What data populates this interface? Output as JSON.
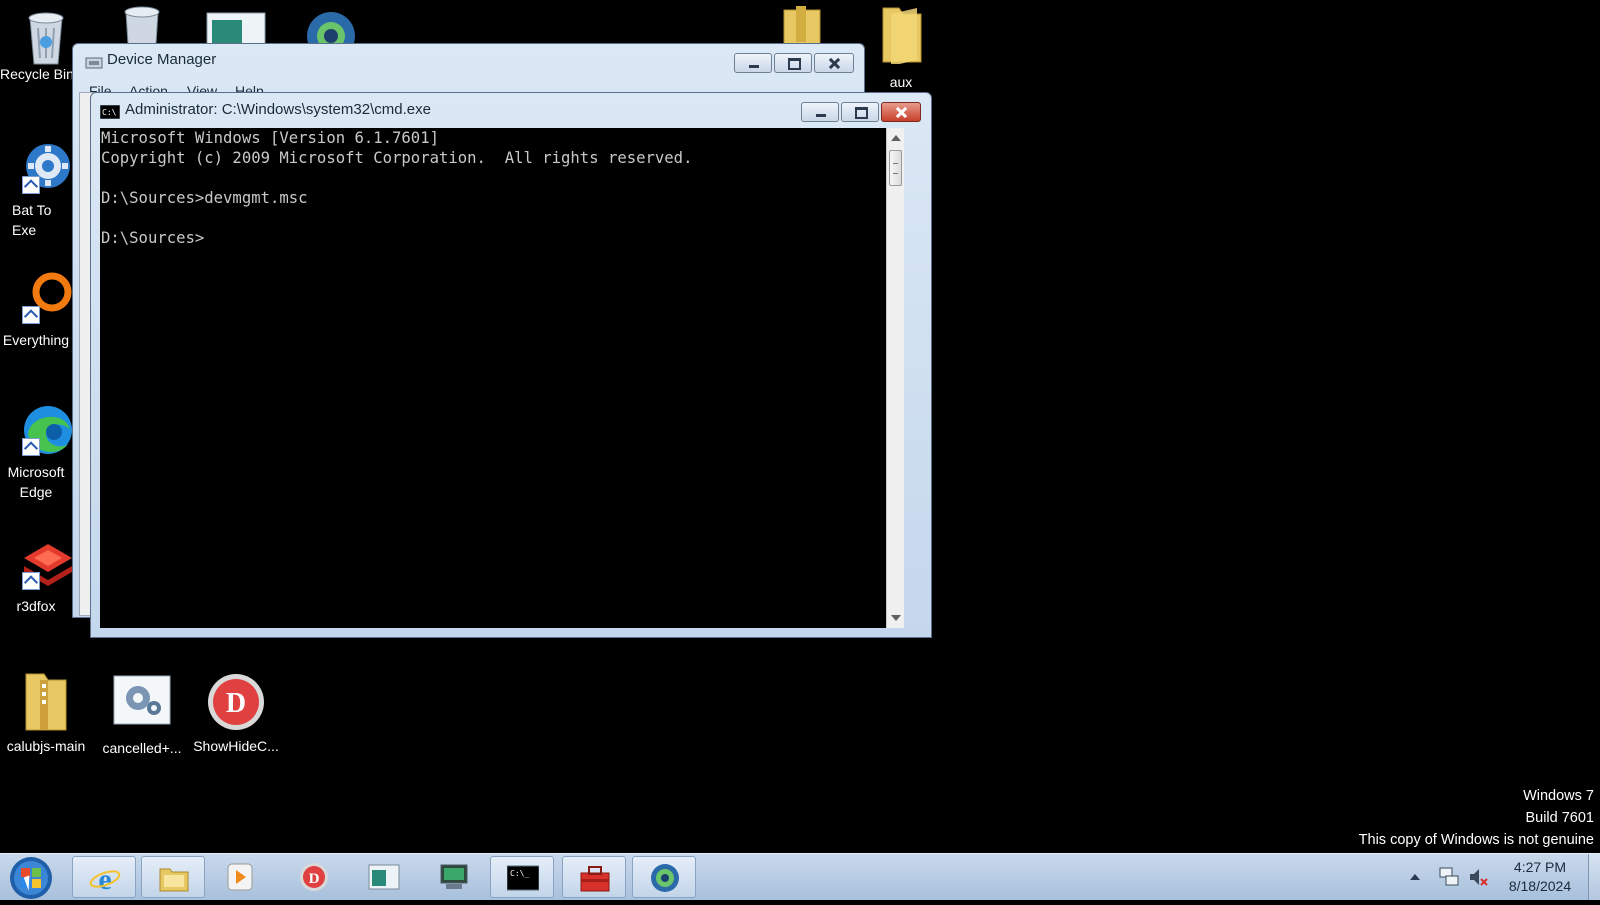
{
  "desktop": {
    "icons_left": [
      {
        "name": "recycle-bin-icon",
        "label": "Recycle Bin"
      },
      {
        "name": "gear-shortcut-icon",
        "label": "Bat To Exe Converter"
      },
      {
        "name": "search-ring-icon",
        "label": "Everything"
      },
      {
        "name": "edge-icon",
        "label": "Microsoft Edge"
      },
      {
        "name": "r3dfox-icon",
        "label": "r3dfox"
      }
    ],
    "icons_bottom": [
      {
        "name": "folder-zip-icon",
        "label": "calubjs-main"
      },
      {
        "name": "settings-app-icon",
        "label": "cancelled+..."
      },
      {
        "name": "d-badge-icon",
        "label": "ShowHideC..."
      }
    ],
    "icons_top_right": [
      {
        "name": "folder-icon",
        "label": ""
      },
      {
        "name": "folder-icon",
        "label": "aux"
      }
    ]
  },
  "device_manager": {
    "title": "Device Manager",
    "menu": [
      "File",
      "Action",
      "View",
      "Help"
    ]
  },
  "cmd": {
    "title": "Administrator: C:\\Windows\\system32\\cmd.exe",
    "lines": [
      "Microsoft Windows [Version 6.1.7601]",
      "Copyright (c) 2009 Microsoft Corporation.  All rights reserved.",
      "",
      "D:\\Sources>devmgmt.msc",
      "",
      "D:\\Sources>"
    ]
  },
  "watermark": {
    "line1": "Windows 7",
    "line2": "Build 7601",
    "line3": "This copy of Windows is not genuine"
  },
  "taskbar": {
    "buttons": [
      {
        "name": "ie-icon"
      },
      {
        "name": "explorer-folder-icon"
      },
      {
        "name": "media-player-icon"
      },
      {
        "name": "d-badge-icon"
      },
      {
        "name": "window-app-icon"
      },
      {
        "name": "monitor-app-icon"
      },
      {
        "name": "cmd-icon"
      },
      {
        "name": "toolbox-icon"
      },
      {
        "name": "globe-app-icon"
      }
    ],
    "clock": {
      "time": "4:27 PM",
      "date": "8/18/2024"
    }
  },
  "colors": {
    "desktop_bg": "#000000",
    "taskbar_bg": "#b7cbe3",
    "close_red": "#c7402b",
    "console_text": "#c8c8c8"
  }
}
